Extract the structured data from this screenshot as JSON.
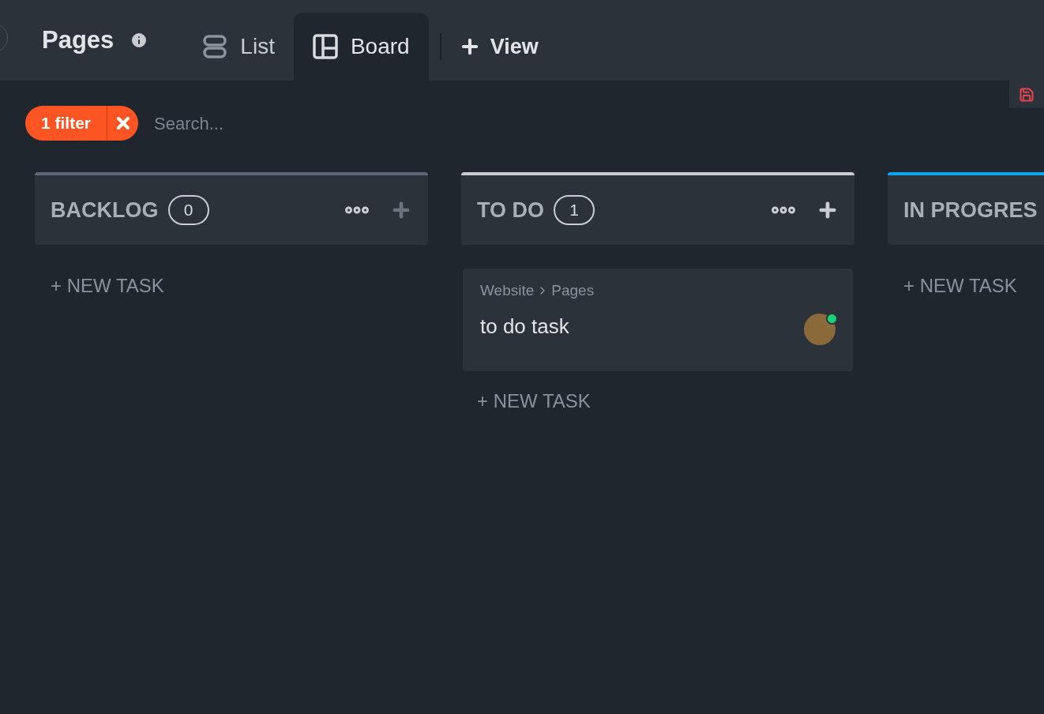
{
  "header": {
    "title": "Pages",
    "views": [
      {
        "label": "List",
        "selected": false
      },
      {
        "label": "Board",
        "selected": true
      }
    ],
    "add_view": "View"
  },
  "filter": {
    "label": "1 filter"
  },
  "search": {
    "placeholder": "Search..."
  },
  "columns": [
    {
      "title": "BACKLOG",
      "count": "0",
      "color": "#5d6978",
      "actions": true,
      "new_task": "+ NEW TASK"
    },
    {
      "title": "TO DO",
      "count": "1",
      "color": "#c9cdd2",
      "actions": true,
      "cards": [
        {
          "path": [
            "Website",
            "Pages"
          ],
          "title": "to do task",
          "assignee_online": true
        }
      ],
      "new_task": "+ NEW TASK"
    },
    {
      "title": "IN PROGRES",
      "color": "#0fa5f0",
      "new_task": "+ NEW TASK"
    }
  ]
}
